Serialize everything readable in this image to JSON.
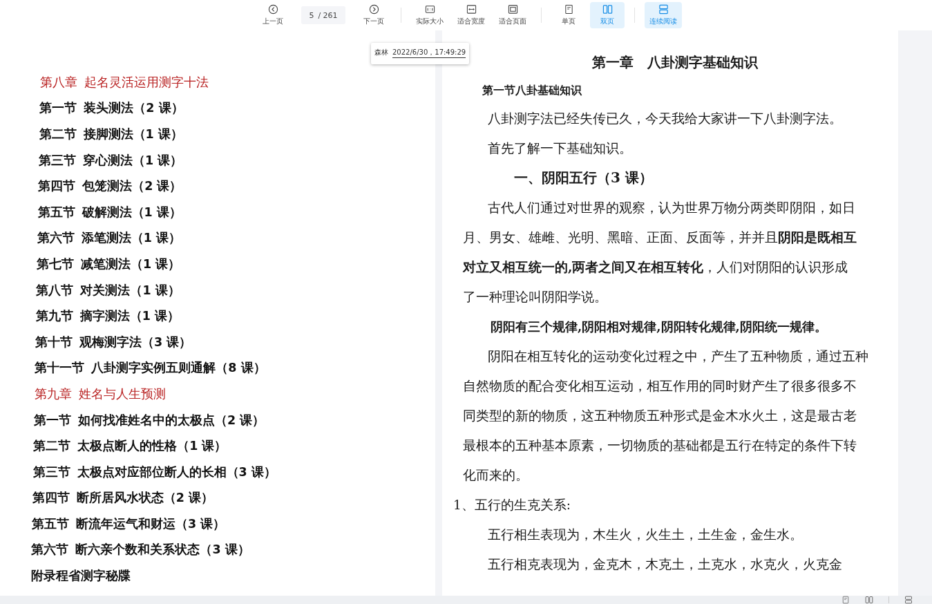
{
  "toolbar": {
    "items": [
      {
        "kind": "prev",
        "label": "上一页"
      },
      {
        "kind": "page",
        "value": "5",
        "total": "/ 261"
      },
      {
        "kind": "next",
        "label": "下一页"
      },
      {
        "kind": "separator"
      },
      {
        "kind": "actual",
        "label": "实际大小"
      },
      {
        "kind": "fitwidth",
        "label": "适合宽度"
      },
      {
        "kind": "fitpage",
        "label": "适合页面"
      },
      {
        "kind": "separator"
      },
      {
        "kind": "single",
        "label": "单页",
        "selected": false
      },
      {
        "kind": "double",
        "label": "双页",
        "selected": true
      },
      {
        "kind": "separator"
      },
      {
        "kind": "continuous",
        "label": "连续阅读",
        "selected": true
      }
    ]
  },
  "comment": {
    "author": "森林",
    "time": "2022/6/30，17:49:29"
  },
  "left_page": {
    "toc": [
      {
        "kind": "chapter",
        "number": "第八章",
        "title": "起名灵活运用测字十法"
      },
      {
        "kind": "section",
        "number": "第一节",
        "title": "装头测法（2 课）"
      },
      {
        "kind": "section",
        "number": "第二节",
        "title": "接脚测法（1 课）"
      },
      {
        "kind": "section",
        "number": "第三节",
        "title": "穿心测法（1 课）"
      },
      {
        "kind": "section",
        "number": "第四节",
        "title": "包笼测法（2 课）"
      },
      {
        "kind": "section",
        "number": "第五节",
        "title": "破解测法（1 课）"
      },
      {
        "kind": "section",
        "number": "第六节",
        "title": "添笔测法（1 课）"
      },
      {
        "kind": "section",
        "number": "第七节",
        "title": "减笔测法（1 课）"
      },
      {
        "kind": "section",
        "number": "第八节",
        "title": "对关测法（1 课）"
      },
      {
        "kind": "section",
        "number": "第九节",
        "title": "摘字测法（1 课）"
      },
      {
        "kind": "section",
        "number": "第十节",
        "title": "观梅测字法（3 课）"
      },
      {
        "kind": "section",
        "number": "第十一节",
        "title": "八卦测字实例五则通解（8 课）"
      },
      {
        "kind": "chapter",
        "number": "第九章",
        "title": "姓名与人生预测"
      },
      {
        "kind": "section",
        "number": "第一节",
        "title": "如何找准姓名中的太极点（2 课）"
      },
      {
        "kind": "section",
        "number": "第二节",
        "title": "太极点断人的性格（1 课）"
      },
      {
        "kind": "section",
        "number": "第三节",
        "title": "太极点对应部位断人的长相（3 课）"
      },
      {
        "kind": "section",
        "number": "第四节",
        "title": "断所居风水状态（2 课）"
      },
      {
        "kind": "section",
        "number": "第五节",
        "title": "断流年运气和财运（3 课）"
      },
      {
        "kind": "section",
        "number": "第六节",
        "title": "断六亲个数和关系状态（3 课）"
      },
      {
        "kind": "appendix",
        "title": "附录程省测字秘牒"
      }
    ]
  },
  "right_page": {
    "lines": [
      {
        "kind": "chapter",
        "text": "第一章　八卦测字基础知识"
      },
      {
        "kind": "section",
        "text": "第一节八卦基础知识"
      },
      {
        "kind": "para",
        "text": "八卦测字法已经失传已久，今天我给大家讲一下八卦测字法。"
      },
      {
        "kind": "para",
        "text": "首先了解一下基础知识。"
      },
      {
        "kind": "heading",
        "text": "一、阴阳五行（3 课）"
      },
      {
        "kind": "para",
        "text": "古代人们通过对世界的观察，认为世界万物分两类即阴阳，如日"
      },
      {
        "kind": "line",
        "text": "月、男女、雄雌、光明、黑暗、正面、反面等，并并且**阴阳是既相互**"
      },
      {
        "kind": "line",
        "text": "**对立又相互统一的,两者之间又在相互转化**，人们对阴阳的认识形成"
      },
      {
        "kind": "line",
        "text": "了一种理论叫阴阳学说。"
      },
      {
        "kind": "bold",
        "text": "阴阳有三个规律,阴阳相对规律,阴阳转化规律,阴阳统一规律。"
      },
      {
        "kind": "para",
        "text": "阴阳在相互转化的运动变化过程之中，产生了五种物质，通过五种"
      },
      {
        "kind": "line",
        "text": "自然物质的配合变化相互运动，相互作用的同时财产生了很多很多不"
      },
      {
        "kind": "line",
        "text": "同类型的新的物质，这五种物质五种形式是金木水火土，这是最古老"
      },
      {
        "kind": "line",
        "text": "最根本的五种基本原素，一切物质的基础都是五行在特定的条件下转"
      },
      {
        "kind": "line",
        "text": "化而来的。"
      },
      {
        "kind": "item",
        "text": "1、五行的生克关系:"
      },
      {
        "kind": "para",
        "text": "五行相生表现为，木生火，火生土，土生金，金生水。"
      },
      {
        "kind": "para",
        "text": "五行相克表现为，金克木，木克土，土克水，水克火，火克金"
      }
    ]
  },
  "status_bar": {
    "items": [
      {
        "kind": "single"
      },
      {
        "kind": "double"
      },
      {
        "kind": "continuous"
      }
    ]
  }
}
